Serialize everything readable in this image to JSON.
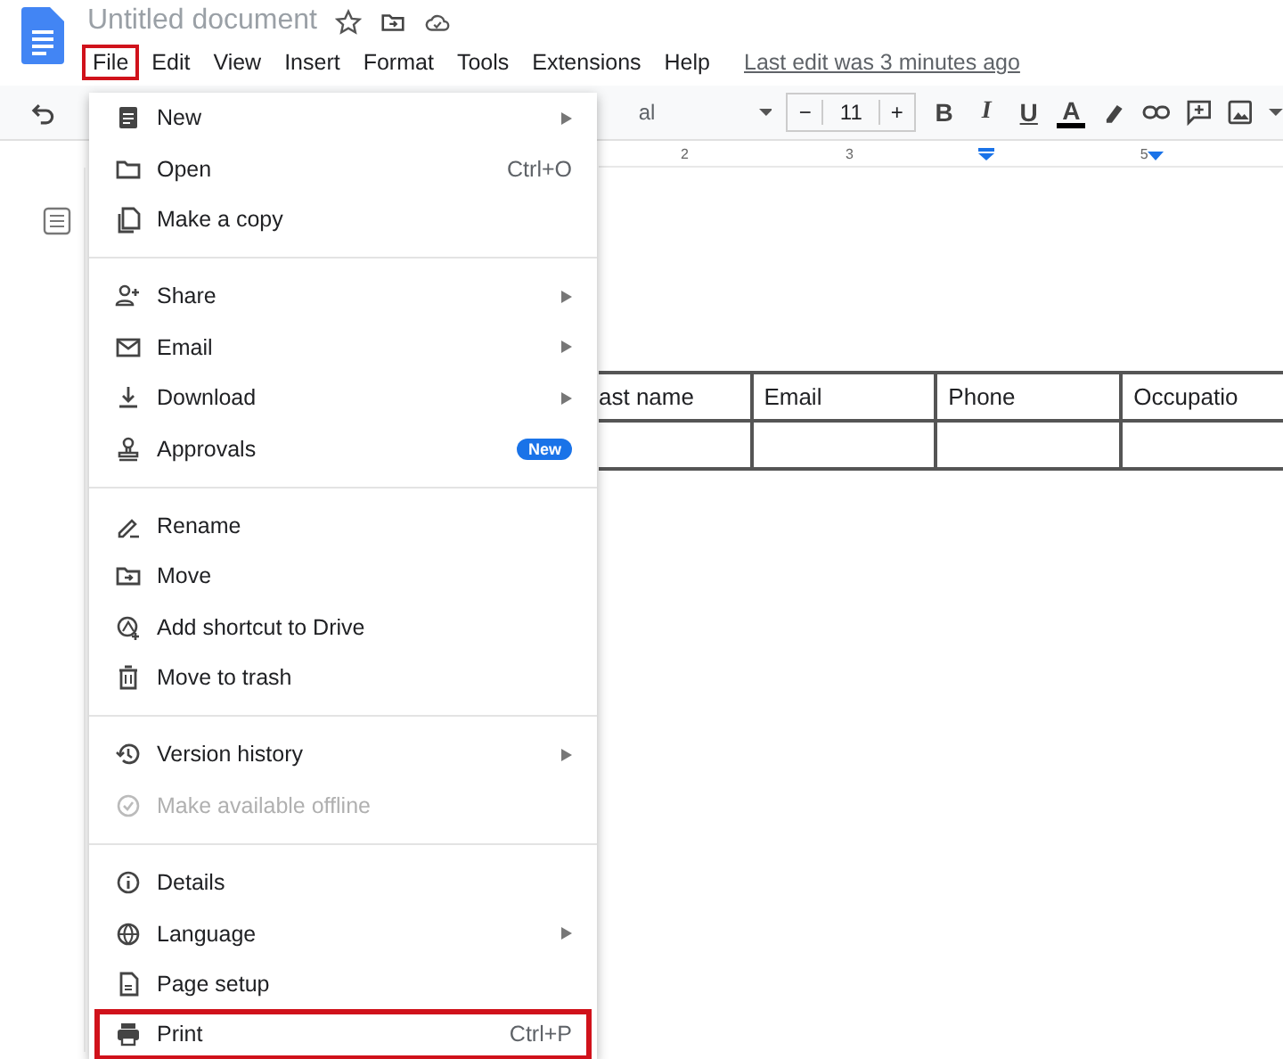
{
  "window": {
    "title": "Untitled document"
  },
  "menubar": [
    {
      "label": "File",
      "highlighted": true
    },
    {
      "label": "Edit",
      "highlighted": false
    },
    {
      "label": "View",
      "highlighted": false
    },
    {
      "label": "Insert",
      "highlighted": false
    },
    {
      "label": "Format",
      "highlighted": false
    },
    {
      "label": "Tools",
      "highlighted": false
    },
    {
      "label": "Extensions",
      "highlighted": false
    },
    {
      "label": "Help",
      "highlighted": false
    }
  ],
  "last_edit": "Last edit was 3 minutes ago",
  "toolbar": {
    "font": "al",
    "font_size": "11",
    "minus": "−",
    "plus": "+",
    "bold": "B",
    "italic": "I",
    "underline": "U",
    "text_color": "A"
  },
  "ruler": {
    "marks": [
      "2",
      "3",
      "5"
    ]
  },
  "table": {
    "columns": [
      "ast name",
      "Email",
      "Phone",
      "Occupatio"
    ]
  },
  "file_menu": {
    "groups": [
      [
        {
          "label": "New",
          "submenu": true,
          "disabled": false,
          "highlighted": false
        },
        {
          "label": "Open",
          "shortcut": "Ctrl+O",
          "submenu": false,
          "disabled": false,
          "highlighted": false
        },
        {
          "label": "Make a copy",
          "submenu": false,
          "disabled": false,
          "highlighted": false
        }
      ],
      [
        {
          "label": "Share",
          "submenu": true,
          "disabled": false,
          "highlighted": false
        },
        {
          "label": "Email",
          "submenu": true,
          "disabled": false,
          "highlighted": false
        },
        {
          "label": "Download",
          "submenu": true,
          "disabled": false,
          "highlighted": false
        },
        {
          "label": "Approvals",
          "submenu": false,
          "disabled": false,
          "highlighted": false,
          "badge": "New"
        }
      ],
      [
        {
          "label": "Rename",
          "submenu": false,
          "disabled": false,
          "highlighted": false
        },
        {
          "label": "Move",
          "submenu": false,
          "disabled": false,
          "highlighted": false
        },
        {
          "label": "Add shortcut to Drive",
          "submenu": false,
          "disabled": false,
          "highlighted": false
        },
        {
          "label": "Move to trash",
          "submenu": false,
          "disabled": false,
          "highlighted": false
        }
      ],
      [
        {
          "label": "Version history",
          "submenu": true,
          "disabled": false,
          "highlighted": false
        },
        {
          "label": "Make available offline",
          "submenu": false,
          "disabled": true,
          "highlighted": false
        }
      ],
      [
        {
          "label": "Details",
          "submenu": false,
          "disabled": false,
          "highlighted": false
        },
        {
          "label": "Language",
          "submenu": true,
          "disabled": false,
          "highlighted": false
        },
        {
          "label": "Page setup",
          "submenu": false,
          "disabled": false,
          "highlighted": false
        },
        {
          "label": "Print",
          "shortcut": "Ctrl+P",
          "submenu": false,
          "disabled": false,
          "highlighted": true
        }
      ]
    ]
  }
}
